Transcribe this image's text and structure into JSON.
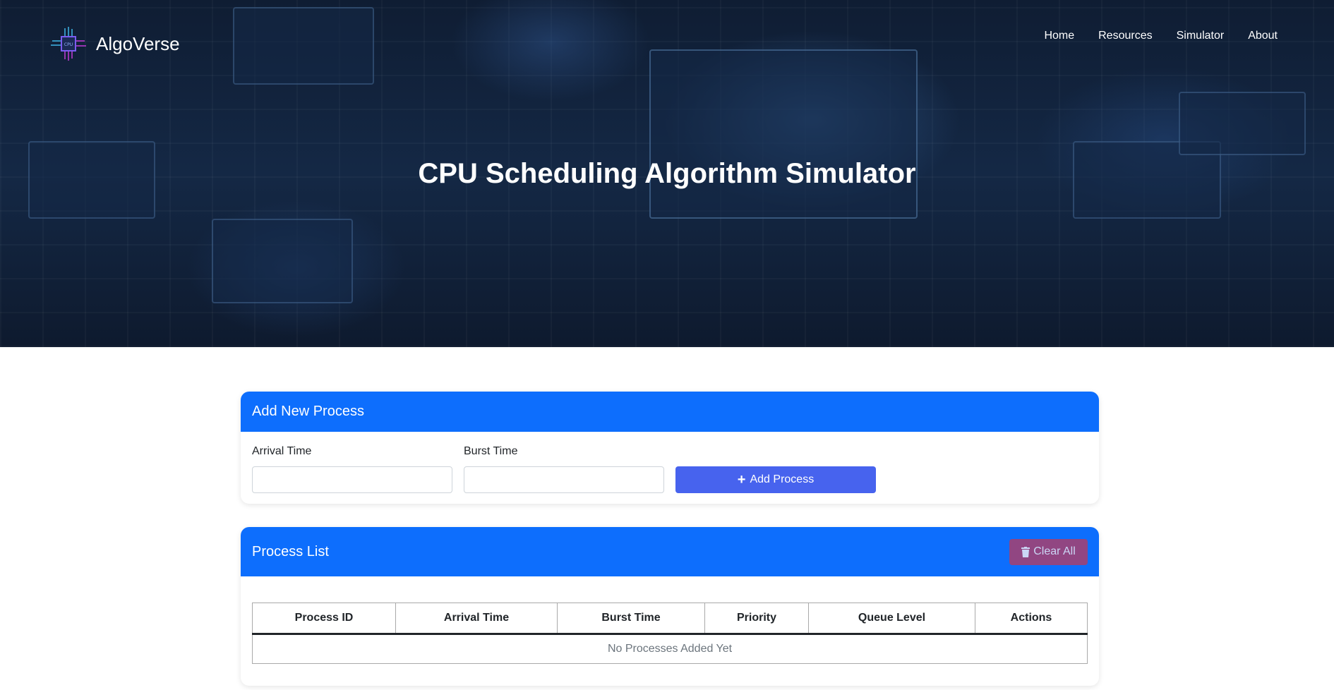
{
  "nav": {
    "brand": "AlgoVerse",
    "links": [
      "Home",
      "Resources",
      "Simulator",
      "About"
    ]
  },
  "hero": {
    "title": "CPU Scheduling Algorithm Simulator"
  },
  "add_process": {
    "title": "Add New Process",
    "arrival_label": "Arrival Time",
    "burst_label": "Burst Time",
    "arrival_value": "",
    "burst_value": "",
    "button": "Add Process"
  },
  "process_list": {
    "title": "Process List",
    "clear_button": "Clear All",
    "columns": [
      "Process ID",
      "Arrival Time",
      "Burst Time",
      "Priority",
      "Queue Level",
      "Actions"
    ],
    "empty": "No Processes Added Yet"
  },
  "colors": {
    "primary": "#0d6efd",
    "add_button": "#4763ee",
    "clear_button": "#914682"
  }
}
